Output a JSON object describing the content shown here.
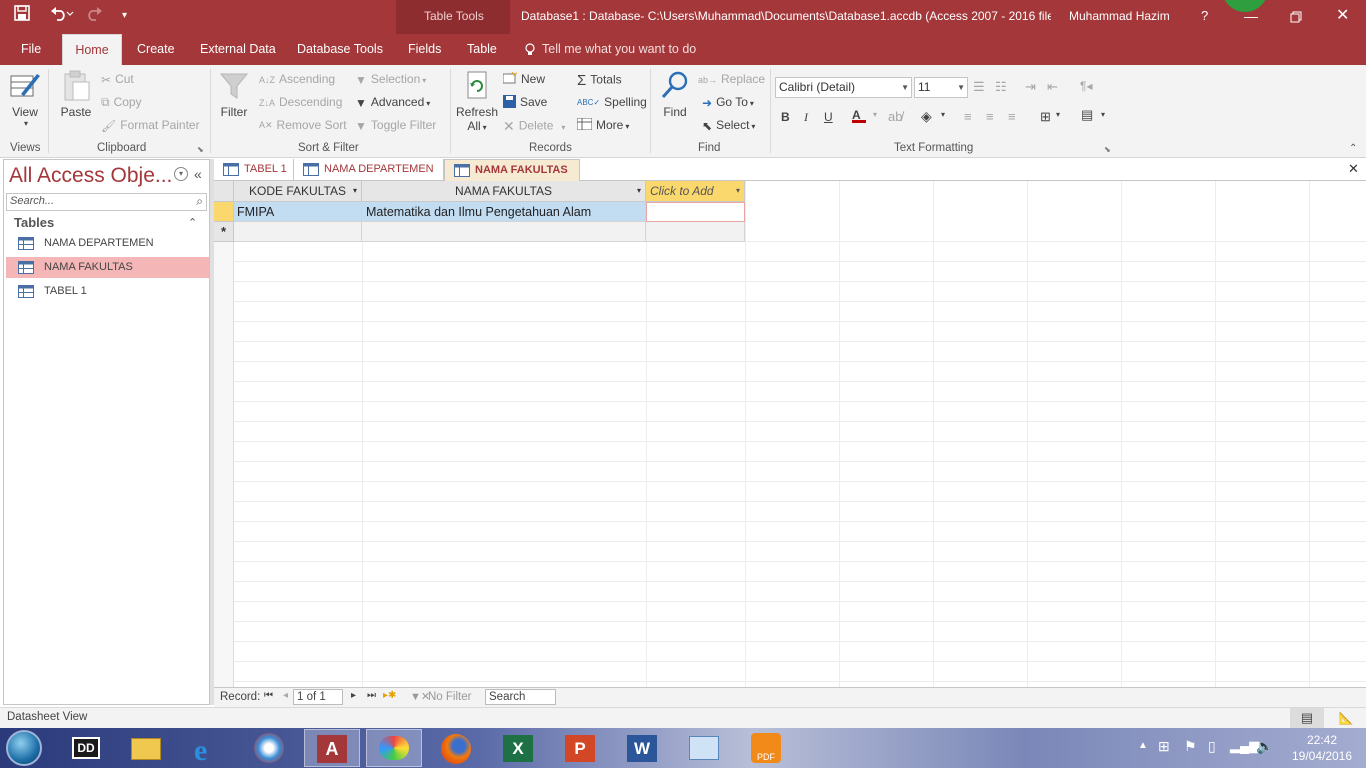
{
  "titlebar": {
    "tool_context": "Table Tools",
    "title": "Database1 : Database- C:\\Users\\Muhammad\\Documents\\Database1.accdb (Access 2007 - 2016 file...",
    "user": "Muhammad Hazim",
    "help": "?"
  },
  "ribbon_tabs": [
    "File",
    "Home",
    "Create",
    "External Data",
    "Database Tools",
    "Fields",
    "Table"
  ],
  "tell_me": "Tell me what you want to do",
  "ribbon": {
    "views": {
      "label": "Views",
      "view": "View"
    },
    "clipboard": {
      "label": "Clipboard",
      "paste": "Paste",
      "cut": "Cut",
      "copy": "Copy",
      "format_painter": "Format Painter"
    },
    "sort_filter": {
      "label": "Sort & Filter",
      "filter": "Filter",
      "ascending": "Ascending",
      "descending": "Descending",
      "remove_sort": "Remove Sort",
      "selection": "Selection",
      "advanced": "Advanced",
      "toggle_filter": "Toggle Filter"
    },
    "records": {
      "label": "Records",
      "refresh": "Refresh",
      "refresh_all": "All",
      "new": "New",
      "save": "Save",
      "delete": "Delete",
      "totals": "Totals",
      "spelling": "Spelling",
      "more": "More"
    },
    "find": {
      "label": "Find",
      "find": "Find",
      "replace": "Replace",
      "goto": "Go To",
      "select": "Select"
    },
    "text_formatting": {
      "label": "Text Formatting",
      "font": "Calibri (Detail)",
      "size": "11",
      "bold": "B",
      "italic": "I",
      "underline": "U"
    }
  },
  "nav": {
    "title": "All Access Obje...",
    "search_placeholder": "Search...",
    "section": "Tables",
    "items": [
      "NAMA DEPARTEMEN",
      "NAMA FAKULTAS",
      "TABEL 1"
    ]
  },
  "doc_tabs": [
    "TABEL 1",
    "NAMA DEPARTEMEN",
    "NAMA FAKULTAS"
  ],
  "table": {
    "columns": [
      "KODE FAKULTAS",
      "NAMA FAKULTAS",
      "Click to Add"
    ],
    "rows": [
      [
        "FMIPA",
        "Matematika dan Ilmu Pengetahuan Alam",
        ""
      ]
    ],
    "new_row_marker": "*"
  },
  "record_nav": {
    "label": "Record:",
    "position": "1 of 1",
    "filter": "No Filter",
    "search": "Search"
  },
  "status": {
    "view": "Datasheet View"
  },
  "taskbar": {
    "time": "22:42",
    "date": "19/04/2016"
  },
  "colors": {
    "accent": "#a4373a",
    "selected_row": "#c2dcf2",
    "nav_selected": "#f4b6b6",
    "add_column": "#fbd86d"
  }
}
